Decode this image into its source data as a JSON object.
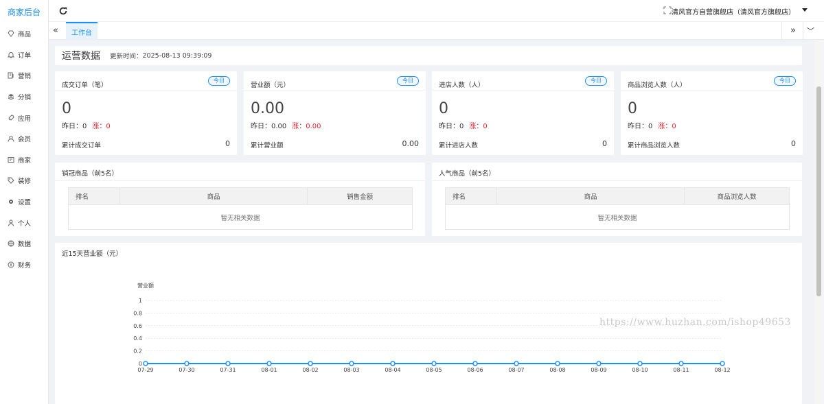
{
  "brand": "商家后台",
  "sidebar": {
    "items": [
      {
        "label": "商品",
        "icon": "diamond-icon"
      },
      {
        "label": "订单",
        "icon": "bell-icon"
      },
      {
        "label": "营销",
        "icon": "marketing-icon"
      },
      {
        "label": "分销",
        "icon": "layers-icon"
      },
      {
        "label": "应用",
        "icon": "rocket-icon"
      },
      {
        "label": "会员",
        "icon": "user-icon"
      },
      {
        "label": "商家",
        "icon": "store-icon"
      },
      {
        "label": "装修",
        "icon": "tag-icon"
      },
      {
        "label": "设置",
        "icon": "gear-icon"
      },
      {
        "label": "个人",
        "icon": "person-icon"
      },
      {
        "label": "数据",
        "icon": "globe-icon"
      },
      {
        "label": "财务",
        "icon": "yen-icon"
      }
    ]
  },
  "topbar": {
    "shop_name": "清风官方自营旗舰店（清风官方旗舰店）"
  },
  "tabs": {
    "items": [
      {
        "label": "工作台",
        "active": true
      }
    ]
  },
  "ops": {
    "title": "运营数据",
    "updated_label": "更新时间：",
    "updated_time": "2025-08-13 09:39:09"
  },
  "stats": [
    {
      "label": "成交订单（笔）",
      "badge": "今日",
      "value": "0",
      "yesterday_label": "昨日：",
      "yesterday_value": "0",
      "rise_label": "涨：",
      "rise_value": "0",
      "cum_label": "累计成交订单",
      "cum_value": "0"
    },
    {
      "label": "营业额（元）",
      "badge": "今日",
      "value": "0.00",
      "yesterday_label": "昨日：",
      "yesterday_value": "0.00",
      "rise_label": "涨：",
      "rise_value": "0.00",
      "cum_label": "累计营业额",
      "cum_value": "0.00"
    },
    {
      "label": "进店人数（人）",
      "badge": "今日",
      "value": "0",
      "yesterday_label": "昨日：",
      "yesterday_value": "0",
      "rise_label": "涨：",
      "rise_value": "0",
      "cum_label": "累计进店人数",
      "cum_value": "0"
    },
    {
      "label": "商品浏览人数（人）",
      "badge": "今日",
      "value": "0",
      "yesterday_label": "昨日：",
      "yesterday_value": "0",
      "rise_label": "涨：",
      "rise_value": "0",
      "cum_label": "累计商品浏览人数",
      "cum_value": "0"
    }
  ],
  "rankings": [
    {
      "title": "销冠商品（前5名）",
      "columns": [
        "排名",
        "商品",
        "销售金额"
      ],
      "empty": "暂无相关数据"
    },
    {
      "title": "人气商品（前5名）",
      "columns": [
        "排名",
        "商品",
        "商品浏览人数"
      ],
      "empty": "暂无相关数据"
    }
  ],
  "chart_title": "近15天营业额（元）",
  "chart_data": {
    "type": "line",
    "title": "近15天营业额（元）",
    "ylabel": "营业额",
    "categories": [
      "07-29",
      "07-30",
      "07-31",
      "08-01",
      "08-02",
      "08-03",
      "08-04",
      "08-05",
      "08-06",
      "08-07",
      "08-08",
      "08-09",
      "08-10",
      "08-11",
      "08-12"
    ],
    "values": [
      0,
      0,
      0,
      0,
      0,
      0,
      0,
      0,
      0,
      0,
      0,
      0,
      0,
      0,
      0
    ],
    "yticks": [
      "0",
      "0.2",
      "0.4",
      "0.6",
      "0.8",
      "1"
    ],
    "ylim": [
      0,
      1
    ],
    "grid": true,
    "color": "#1890ff"
  },
  "watermark": "https://www.huzhan.com/ishop49653",
  "colors": {
    "accent": "#1890ff",
    "rise": "#f5222d"
  }
}
